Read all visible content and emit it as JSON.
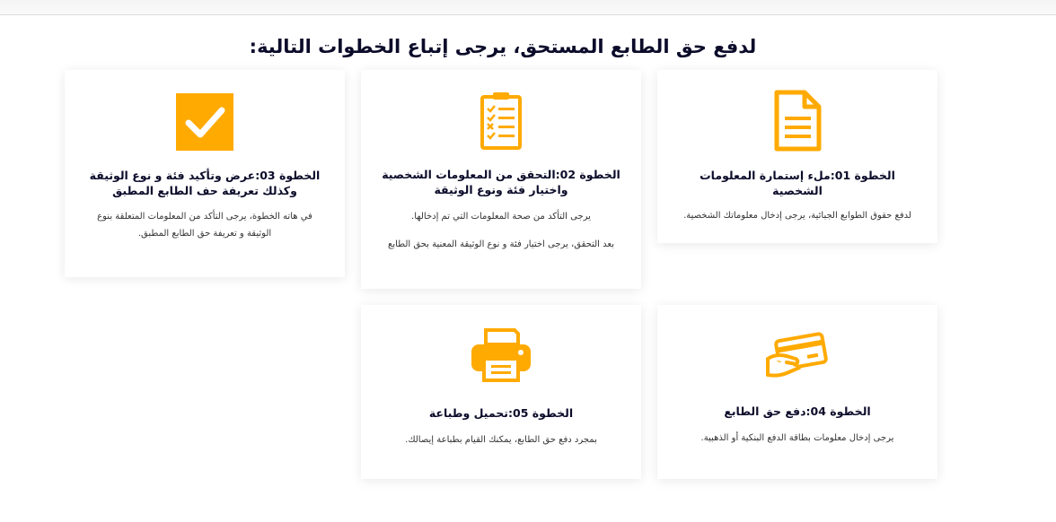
{
  "page": {
    "title": "لدفع حق الطابع المستحق، يرجى إتباع الخطوات التالية:"
  },
  "colors": {
    "accent": "#FFAA00",
    "title": "#0B0B2A",
    "text": "#333333"
  },
  "steps": [
    {
      "icon": "document-icon",
      "title": "الخطوة 01:ملء إستمارة المعلومات الشخصية",
      "texts": [
        "لدفع حقوق الطوابع الجبائية، يرجى إدخال معلوماتك الشخصية."
      ]
    },
    {
      "icon": "checklist-icon",
      "title": "الخطوة 02:التحقق من المعلومات الشخصية واختيار فئة ونوع الوثيقة",
      "texts": [
        "يرجى التأكد من صحة المعلومات التي تم إدخالها.",
        "بعد التحقق، يرجى اختيار فئة و نوع الوثيقة المعنية بحق الطابع"
      ]
    },
    {
      "icon": "checkmark-box-icon",
      "title": "الخطوة 03:عرض وتأكيد فئة و نوع الوثيقة وكذلك تعريفة حف الطابع المطبق",
      "texts": [
        "في هاته الخطوة، يرجى التأكد من المعلومات المتعلقة بنوع الوثيقة و تعريفة حق الطابع المطبق."
      ]
    },
    {
      "icon": "credit-card-icon",
      "title": "الخطوة 04:دفع حق الطابع",
      "texts": [
        "يرجى إدخال معلومات بطاقة الدفع البنكية أو الذهبية."
      ]
    },
    {
      "icon": "printer-icon",
      "title": "الخطوة 05:تحميل وطباعة",
      "texts": [
        "بمجرد دفع حق الطابع، يمكنك القيام بطباعة إيصالك."
      ]
    }
  ]
}
